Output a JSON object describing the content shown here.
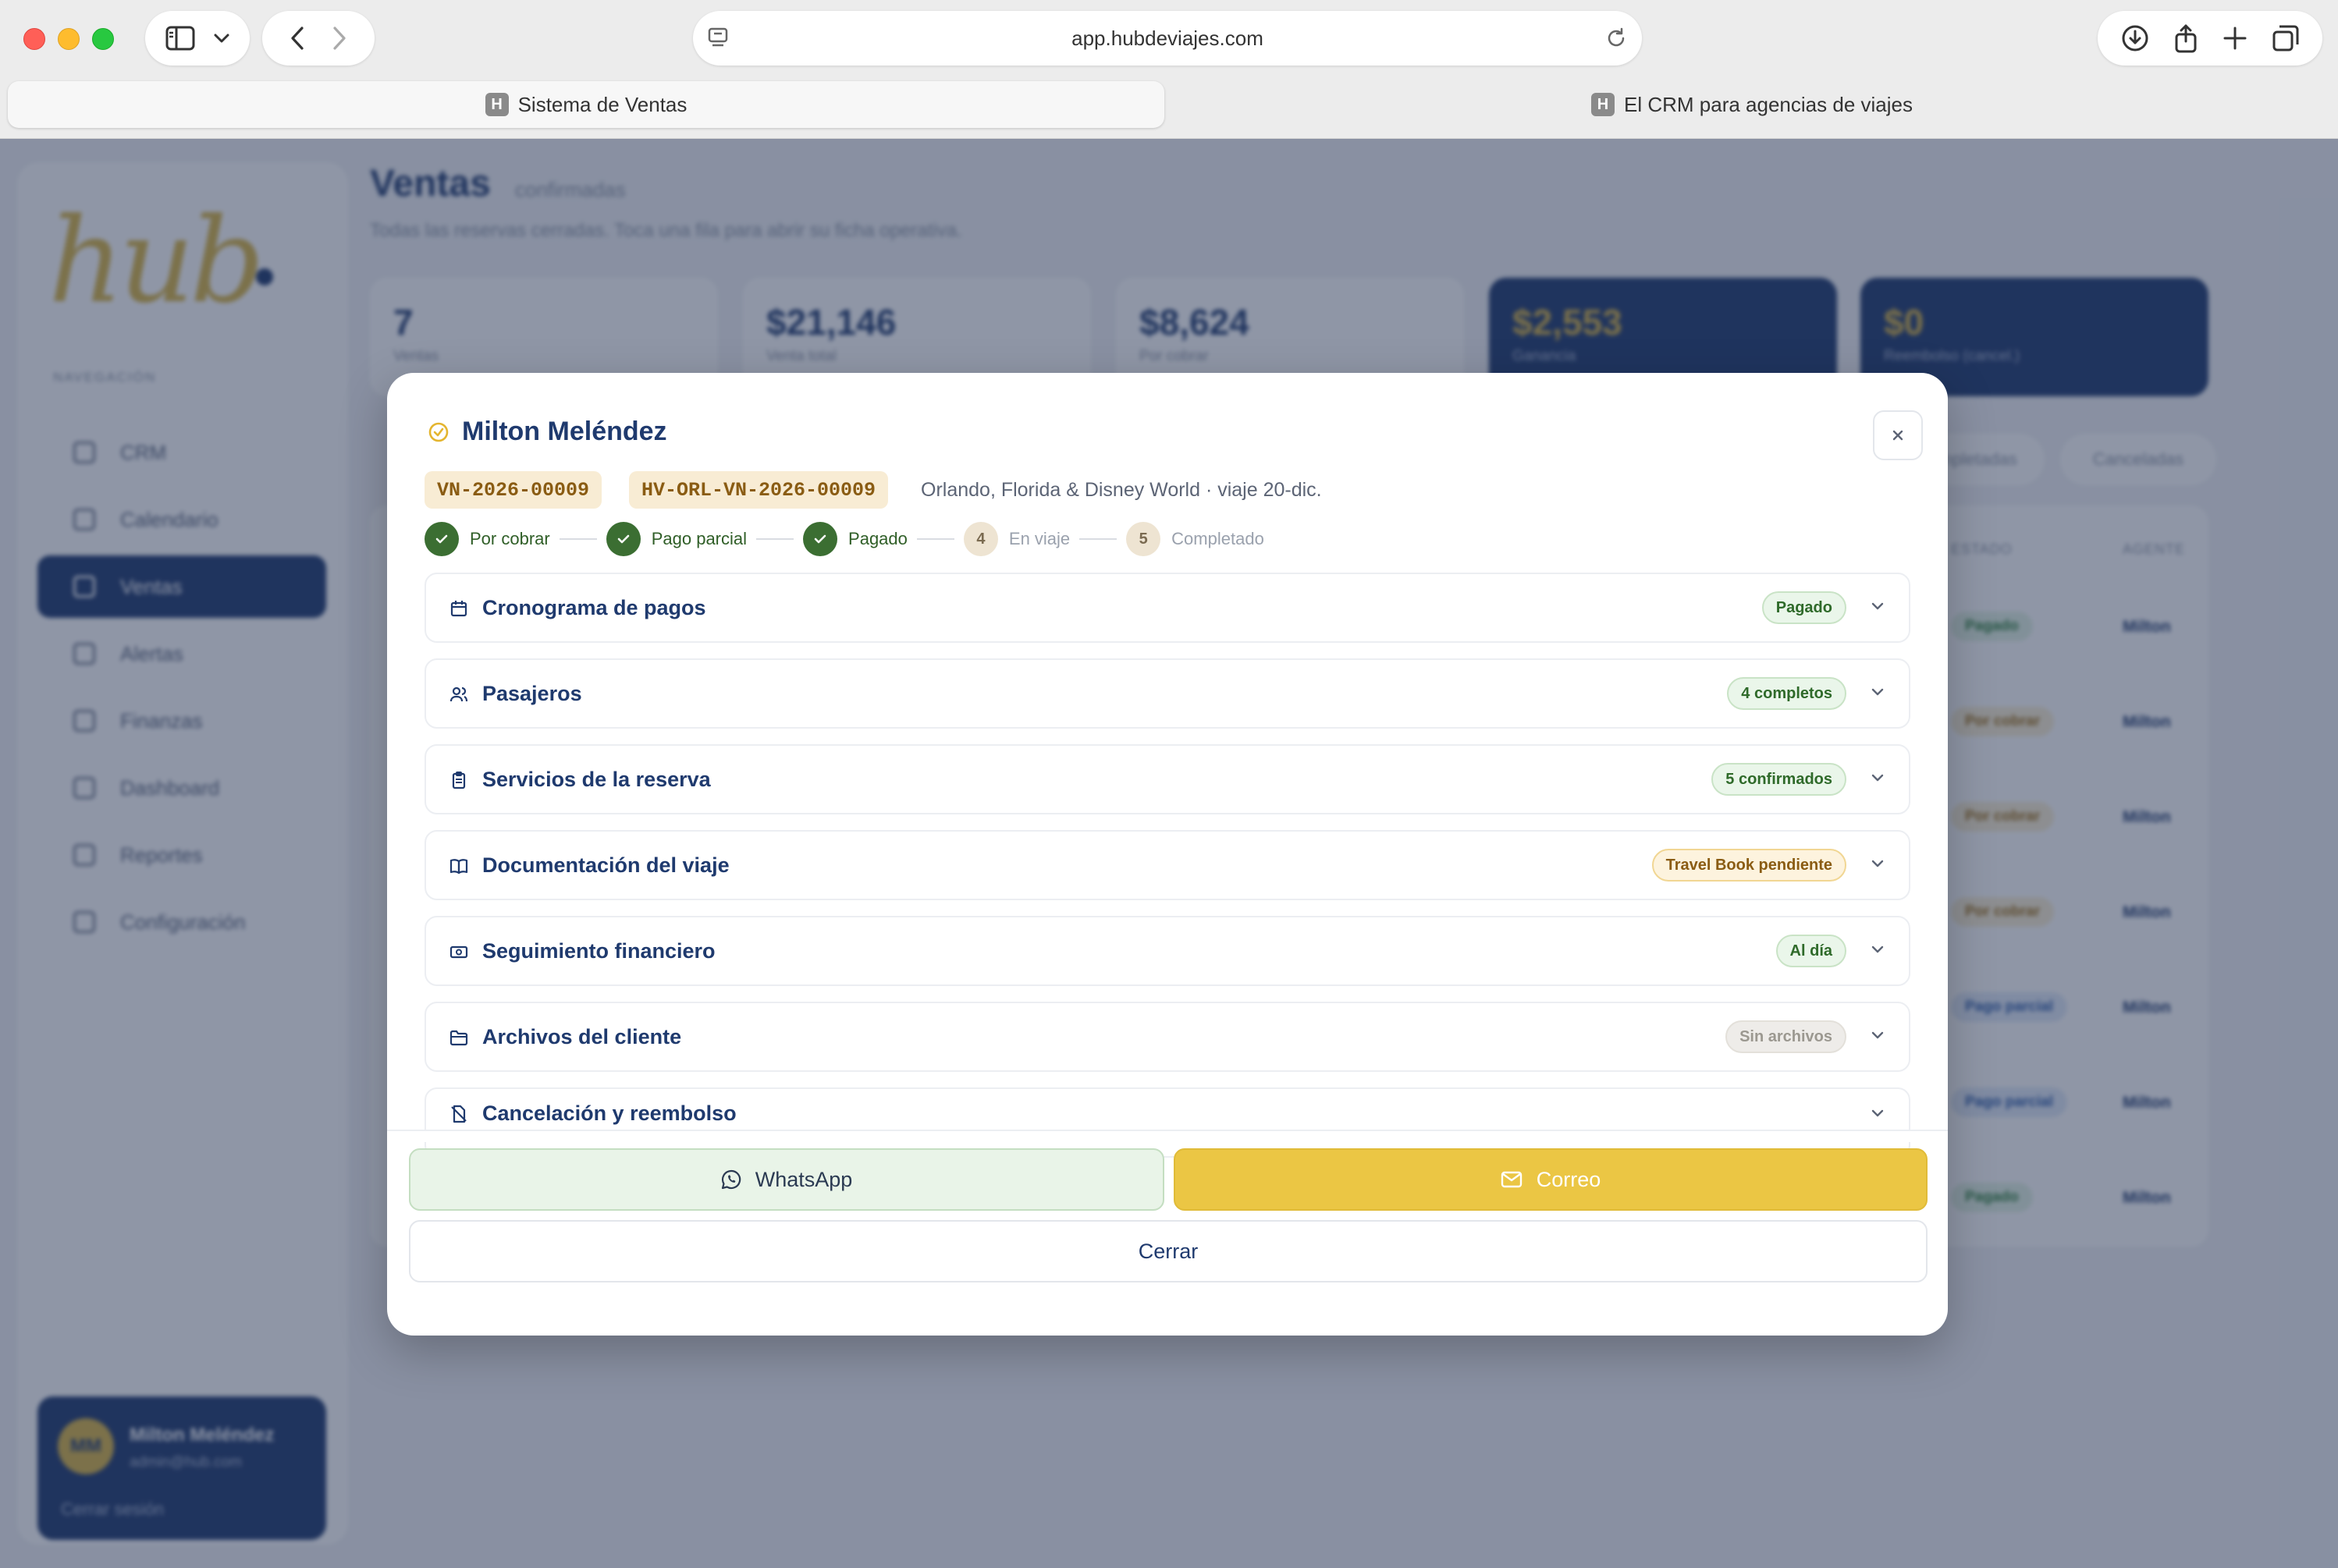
{
  "browser": {
    "url": "app.hubdeviajes.com",
    "tabs": [
      {
        "favicon": "H",
        "label": "Sistema de Ventas",
        "active": true
      },
      {
        "favicon": "H",
        "label": "El CRM para agencias de viajes",
        "active": false
      }
    ]
  },
  "app": {
    "logo_text": "hub",
    "sidebar_section": "NAVEGACIÓN",
    "nav": [
      {
        "label": "CRM",
        "active": false
      },
      {
        "label": "Calendario",
        "active": false
      },
      {
        "label": "Ventas",
        "active": true
      },
      {
        "label": "Alertas",
        "active": false
      },
      {
        "label": "Finanzas",
        "active": false
      },
      {
        "label": "Dashboard",
        "active": false
      },
      {
        "label": "Reportes",
        "active": false
      },
      {
        "label": "Configuración",
        "active": false
      }
    ],
    "user": {
      "initials": "MM",
      "name": "Milton Meléndez",
      "email": "admin@hub.com",
      "logout": "Cerrar sesión"
    },
    "page_title": "Ventas",
    "page_title_sub": "confirmadas",
    "page_desc": "Todas las reservas cerradas. Toca una fila para abrir su ficha operativa.",
    "stats": [
      {
        "value": "7",
        "label": "Ventas"
      },
      {
        "value": "$21,146",
        "label": "Venta total"
      },
      {
        "value": "$8,624",
        "label": "Por cobrar"
      },
      {
        "value": "$2,553",
        "label": "Ganancia"
      },
      {
        "value": "$0",
        "label": "Reembolso (cancel.)"
      }
    ],
    "filters": [
      "Completadas",
      "Canceladas"
    ],
    "table_headers": [
      "ESTADO",
      "AGENTE"
    ],
    "rows": [
      {
        "status": "Pagado",
        "agent": "Milton"
      },
      {
        "status": "Por cobrar",
        "agent": "Milton"
      },
      {
        "status": "Por cobrar",
        "agent": "Milton"
      },
      {
        "status": "Por cobrar",
        "agent": "Milton"
      },
      {
        "status": "Pago parcial",
        "agent": "Milton"
      },
      {
        "status": "Pago parcial",
        "agent": "Milton"
      },
      {
        "status": "Pagado",
        "agent": "Milton"
      }
    ]
  },
  "modal": {
    "client_name": "Milton Meléndez",
    "codes": [
      "VN-2026-00009",
      "HV-ORL-VN-2026-00009"
    ],
    "trip": "Orlando, Florida & Disney World · viaje 20-dic.",
    "steps": [
      {
        "num": "1",
        "label": "Por cobrar",
        "done": true
      },
      {
        "num": "2",
        "label": "Pago parcial",
        "done": true
      },
      {
        "num": "3",
        "label": "Pagado",
        "done": true
      },
      {
        "num": "4",
        "label": "En viaje",
        "done": false
      },
      {
        "num": "5",
        "label": "Completado",
        "done": false
      }
    ],
    "sections": [
      {
        "icon": "calendar-icon",
        "title": "Cronograma de pagos",
        "badge": "Pagado",
        "badge_tone": "green"
      },
      {
        "icon": "users-icon",
        "title": "Pasajeros",
        "badge": "4 completos",
        "badge_tone": "green"
      },
      {
        "icon": "clipboard-icon",
        "title": "Servicios de la reserva",
        "badge": "5 confirmados",
        "badge_tone": "green"
      },
      {
        "icon": "book-icon",
        "title": "Documentación del viaje",
        "badge": "Travel Book pendiente",
        "badge_tone": "amber"
      },
      {
        "icon": "banknote-icon",
        "title": "Seguimiento financiero",
        "badge": "Al día",
        "badge_tone": "green"
      },
      {
        "icon": "folder-icon",
        "title": "Archivos del cliente",
        "badge": "Sin archivos",
        "badge_tone": "gray"
      },
      {
        "icon": "file-x-icon",
        "title": "Cancelación y reembolso",
        "badge": "",
        "badge_tone": ""
      }
    ],
    "buttons": {
      "whatsapp": "WhatsApp",
      "email": "Correo",
      "close": "Cerrar"
    }
  },
  "colors": {
    "navy": "#1f3a6e",
    "gold": "#ebc644",
    "green": "#3b6e32"
  }
}
